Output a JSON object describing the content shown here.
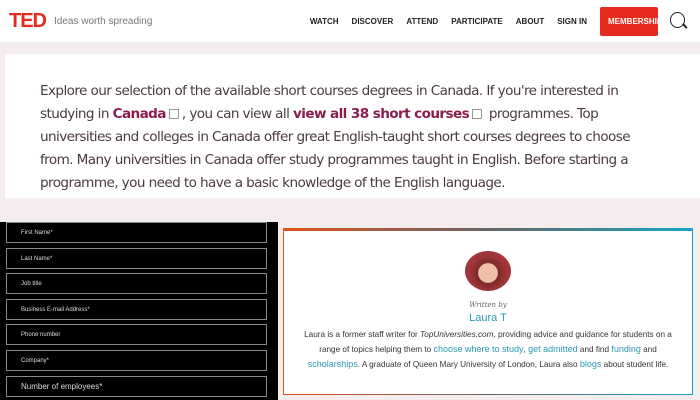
{
  "header": {
    "logo": "TED",
    "tagline": "Ideas worth spreading",
    "nav": [
      "WATCH",
      "DISCOVER",
      "ATTEND",
      "PARTICIPATE",
      "ABOUT",
      "SIGN IN"
    ],
    "membership": "MEMBERSHIP"
  },
  "intro": {
    "p1": "Explore our selection of the available short courses degrees in Canada. If you're interested in studying in ",
    "link1": "Canada",
    "p2": ", you can view all ",
    "link2": "view all 38 short courses",
    "p3": " programmes. Top universities and colleges in Canada offer great English-taught short courses degrees to choose from. Many universities in Canada offer study programmes taught in English. Before starting a programme, you need to have a basic knowledge of the English language."
  },
  "form": {
    "fields": [
      "First Name*",
      "Last Name*",
      "Job title",
      "Business E-mail Address*",
      "Phone number",
      "Company*",
      "Number of employees*"
    ]
  },
  "author": {
    "written_by": "Written by",
    "name": "Laura T",
    "b1": "Laura is a former staff writer for ",
    "site": "TopUniversities.com",
    "b2": ", providing advice and guidance for students on a range of topics helping them to ",
    "l1": "choose where to study",
    "b3": ", ",
    "l2": "get admitted",
    "b4": " and find ",
    "l3": "funding",
    "b5": " and ",
    "l4": "scholarships",
    "b6": ". A graduate of Queen Mary University of London, Laura also ",
    "l5": "blogs",
    "b7": " about student life."
  }
}
